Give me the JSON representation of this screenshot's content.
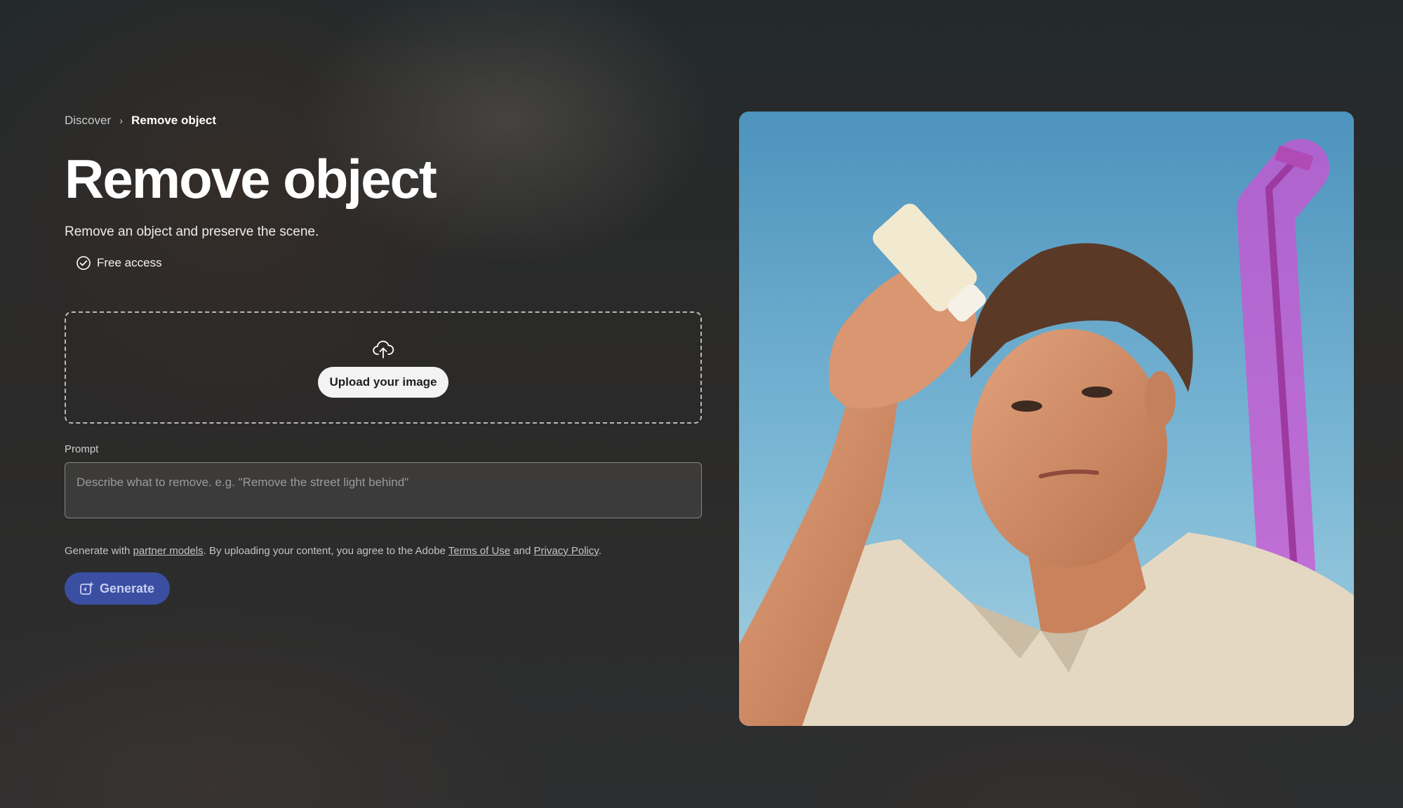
{
  "breadcrumb": {
    "parent": "Discover",
    "separator": "›",
    "current": "Remove object"
  },
  "title": "Remove object",
  "subtitle": "Remove an object and preserve the scene.",
  "badge": {
    "label": "Free access",
    "icon": "check-circle-icon"
  },
  "upload": {
    "icon": "cloud-upload-icon",
    "button_label": "Upload your image"
  },
  "prompt": {
    "label": "Prompt",
    "placeholder": "Describe what to remove. e.g. \"Remove the street light behind\"",
    "value": ""
  },
  "legal": {
    "prefix": "Generate with",
    "partner_link": "partner models",
    "middle": ". By uploading your content, you agree to the Adobe",
    "terms_link": "Terms of Use",
    "and": "and",
    "privacy_link": "Privacy Policy",
    "suffix": "."
  },
  "generate": {
    "label": "Generate",
    "icon": "generate-sparkle-icon"
  },
  "colors": {
    "accent": "#3a4fa2",
    "mask_highlight": "#d24fd2",
    "sky": "#6fb0d0"
  }
}
